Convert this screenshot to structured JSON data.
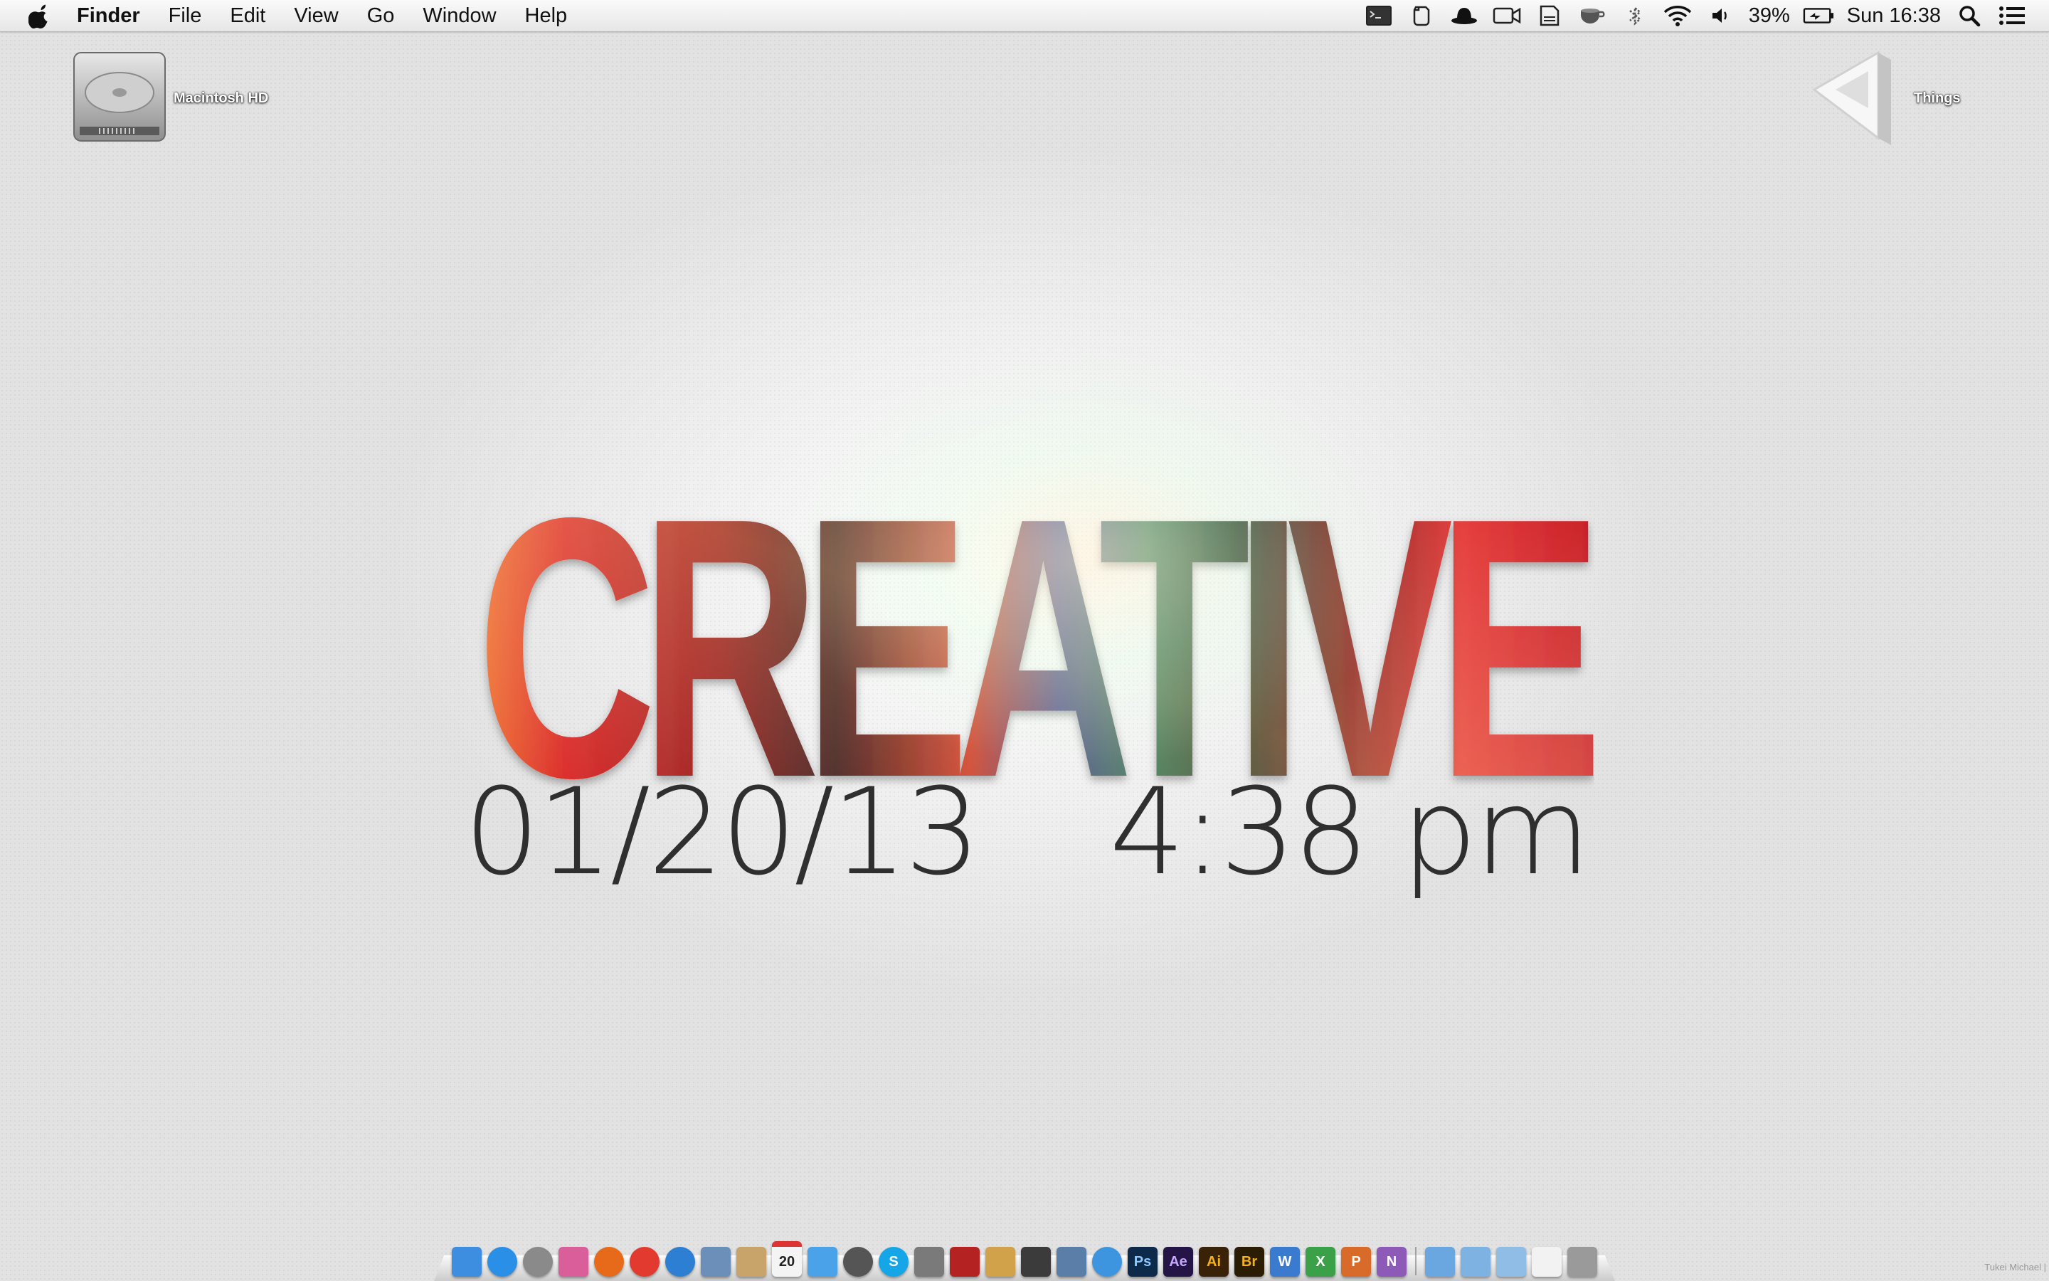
{
  "menubar": {
    "app_name": "Finder",
    "menus": [
      "File",
      "Edit",
      "View",
      "Go",
      "Window",
      "Help"
    ],
    "battery_percent": "39%",
    "clock": "Sun 16:38",
    "status_icons": [
      "terminal-icon",
      "evernote-icon",
      "alfred-hat-icon",
      "facetime-icon",
      "dropbox-icon",
      "caffeine-icon",
      "bluetooth-icon",
      "wifi-icon",
      "volume-icon",
      "battery-icon",
      "spotlight-icon",
      "notification-center-icon"
    ]
  },
  "desktop": {
    "icons": [
      {
        "label": "Macintosh HD",
        "icon": "hard-drive-icon"
      },
      {
        "label": "Things",
        "icon": "things-icon"
      }
    ]
  },
  "wallpaper": {
    "headline": "CREATIVE",
    "date": "01/20/13",
    "time": "4:38 pm",
    "credit": "Tukei Michael |"
  },
  "dock": {
    "calendar_day": "20",
    "apps": [
      {
        "name": "finder-icon",
        "text": "",
        "color": "#3d8de0"
      },
      {
        "name": "app-store-icon",
        "text": "",
        "color": "#2a8fe6"
      },
      {
        "name": "launchpad-icon",
        "text": "",
        "color": "#8a8a8a"
      },
      {
        "name": "gamecenter-icon",
        "text": "",
        "color": "#d95e9a"
      },
      {
        "name": "firefox-icon",
        "text": "",
        "color": "#e66a1a"
      },
      {
        "name": "chrome-icon",
        "text": "",
        "color": "#e23a2e"
      },
      {
        "name": "safari-icon",
        "text": "",
        "color": "#2d7fd4"
      },
      {
        "name": "preview-icon",
        "text": "",
        "color": "#6b8fb8"
      },
      {
        "name": "contacts-icon",
        "text": "",
        "color": "#c9a46a"
      },
      {
        "name": "calendar-icon",
        "text": "20",
        "color": "#f4f4f4"
      },
      {
        "name": "messages-icon",
        "text": "",
        "color": "#4aa3e8"
      },
      {
        "name": "camera-icon",
        "text": "",
        "color": "#555555"
      },
      {
        "name": "skype-icon",
        "text": "S",
        "color": "#14a6e6"
      },
      {
        "name": "system-preferences-icon",
        "text": "",
        "color": "#7a7a7a"
      },
      {
        "name": "photo-booth-icon",
        "text": "",
        "color": "#b52222"
      },
      {
        "name": "garageband-icon",
        "text": "",
        "color": "#d1a24a"
      },
      {
        "name": "imovie-icon",
        "text": "",
        "color": "#3b3b3b"
      },
      {
        "name": "iphoto-icon",
        "text": "",
        "color": "#5a7ea8"
      },
      {
        "name": "itunes-icon",
        "text": "",
        "color": "#3d95e0"
      },
      {
        "name": "photoshop-icon",
        "text": "Ps",
        "color": "#0d2a4a"
      },
      {
        "name": "after-effects-icon",
        "text": "Ae",
        "color": "#241546"
      },
      {
        "name": "illustrator-icon",
        "text": "Ai",
        "color": "#3a2208"
      },
      {
        "name": "bridge-icon",
        "text": "Br",
        "color": "#2a1d04"
      },
      {
        "name": "word-icon",
        "text": "W",
        "color": "#3a7bd0"
      },
      {
        "name": "excel-icon",
        "text": "X",
        "color": "#3aa148"
      },
      {
        "name": "powerpoint-icon",
        "text": "P",
        "color": "#d86a2a"
      },
      {
        "name": "onenote-icon",
        "text": "N",
        "color": "#8d5ab8"
      }
    ],
    "stacks": [
      {
        "name": "downloads-stack-icon",
        "color": "#6aa6e0"
      },
      {
        "name": "documents-stack-icon",
        "color": "#7eb2e2"
      },
      {
        "name": "applications-stack-icon",
        "color": "#8fbde6"
      },
      {
        "name": "desktop-stack-icon",
        "color": "#f2f2f2"
      },
      {
        "name": "trash-icon",
        "color": "#9a9a9a"
      }
    ]
  }
}
